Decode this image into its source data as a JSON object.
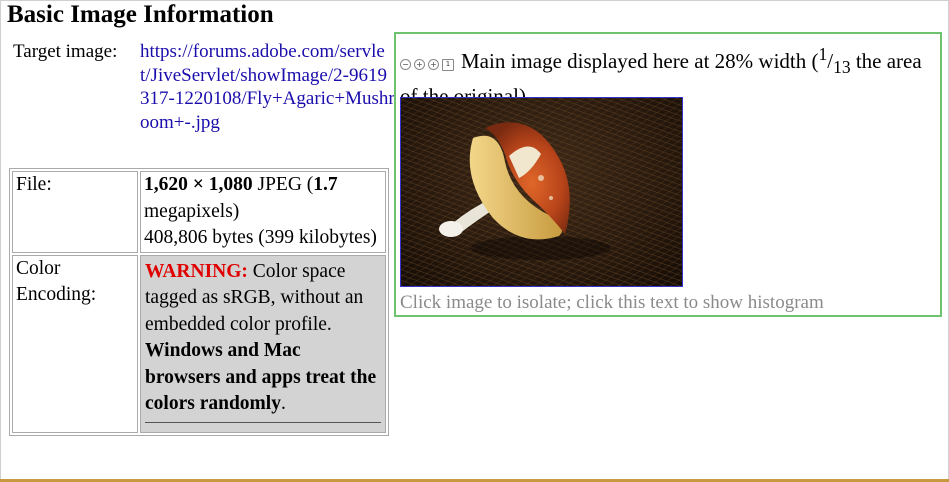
{
  "page": {
    "title": "Basic Image Information"
  },
  "target": {
    "label": "Target image:",
    "url": "https://forums.adobe.com/servlet/JiveServlet/showImage/2-9619317-1220108/Fly+Agaric+Mushroom+-.jpg"
  },
  "table": {
    "file_label": "File:",
    "dims": "1,620 × 1,080",
    "format": "JPEG (",
    "megapixels": "1.7",
    "megapixels_unit": "megapixels)",
    "bytes": "408,806 bytes (399 kilobytes)",
    "color_label": "Color Encoding:",
    "warning_label": "WARNING:",
    "warning_text": "Color space tagged as sRGB, without an embedded color profile.",
    "warning_bold": "Windows and Mac browsers and apps treat the colors randomly",
    "warning_end": "."
  },
  "panel": {
    "caption_pre": "Main image displayed here at 28% width (",
    "frac_num": "1",
    "frac_sep": "/",
    "frac_den": "13",
    "caption_post": " the area of the original)",
    "isolate_text": "Click image to isolate; click this text to show histogram",
    "icons": [
      "zoom-out-icon",
      "zoom-in-icon",
      "zoom-in-alt-icon",
      "actual-size-icon"
    ]
  },
  "colors": {
    "link": "#1a0dab",
    "warning": "#e00000",
    "panel_border": "#6fc36f",
    "photo_border": "#3333cc",
    "muted_caption": "#8a8a8a"
  }
}
